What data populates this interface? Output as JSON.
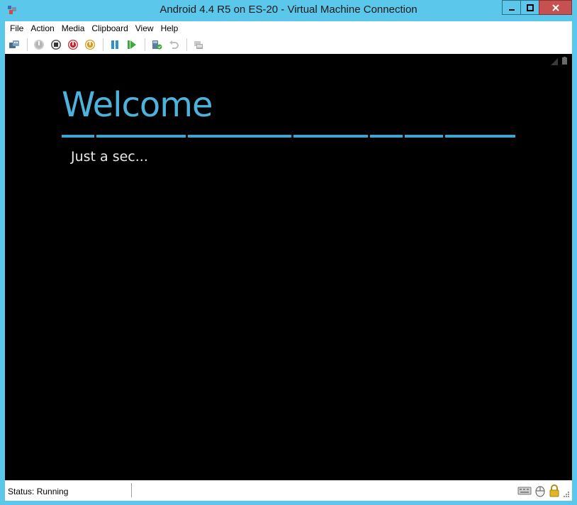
{
  "window": {
    "title": "Android 4.4 R5 on ES-20 - Virtual Machine Connection",
    "controls": [
      "minimize-icon",
      "maximize-icon",
      "close-icon"
    ]
  },
  "menubar": {
    "items": [
      "File",
      "Action",
      "Media",
      "Clipboard",
      "View",
      "Help"
    ]
  },
  "toolbar": {
    "buttons": [
      "ctrl-alt-del-icon",
      "start-icon",
      "turn-off-icon",
      "shut-down-icon",
      "save-icon",
      "pause-icon",
      "resume-icon",
      "checkpoint-icon",
      "revert-icon",
      "enhanced-session-icon"
    ]
  },
  "vm_screen": {
    "heading": "Welcome",
    "subtitle": "Just a sec...",
    "accent_color": "#4db3dc",
    "background": "#000000"
  },
  "statusbar": {
    "status": "Status: Running",
    "icons": [
      "keyboard-icon",
      "mouse-icon",
      "lock-icon"
    ]
  },
  "colors": {
    "window_frame": "#5bc7ea",
    "close_button": "#c75050"
  }
}
